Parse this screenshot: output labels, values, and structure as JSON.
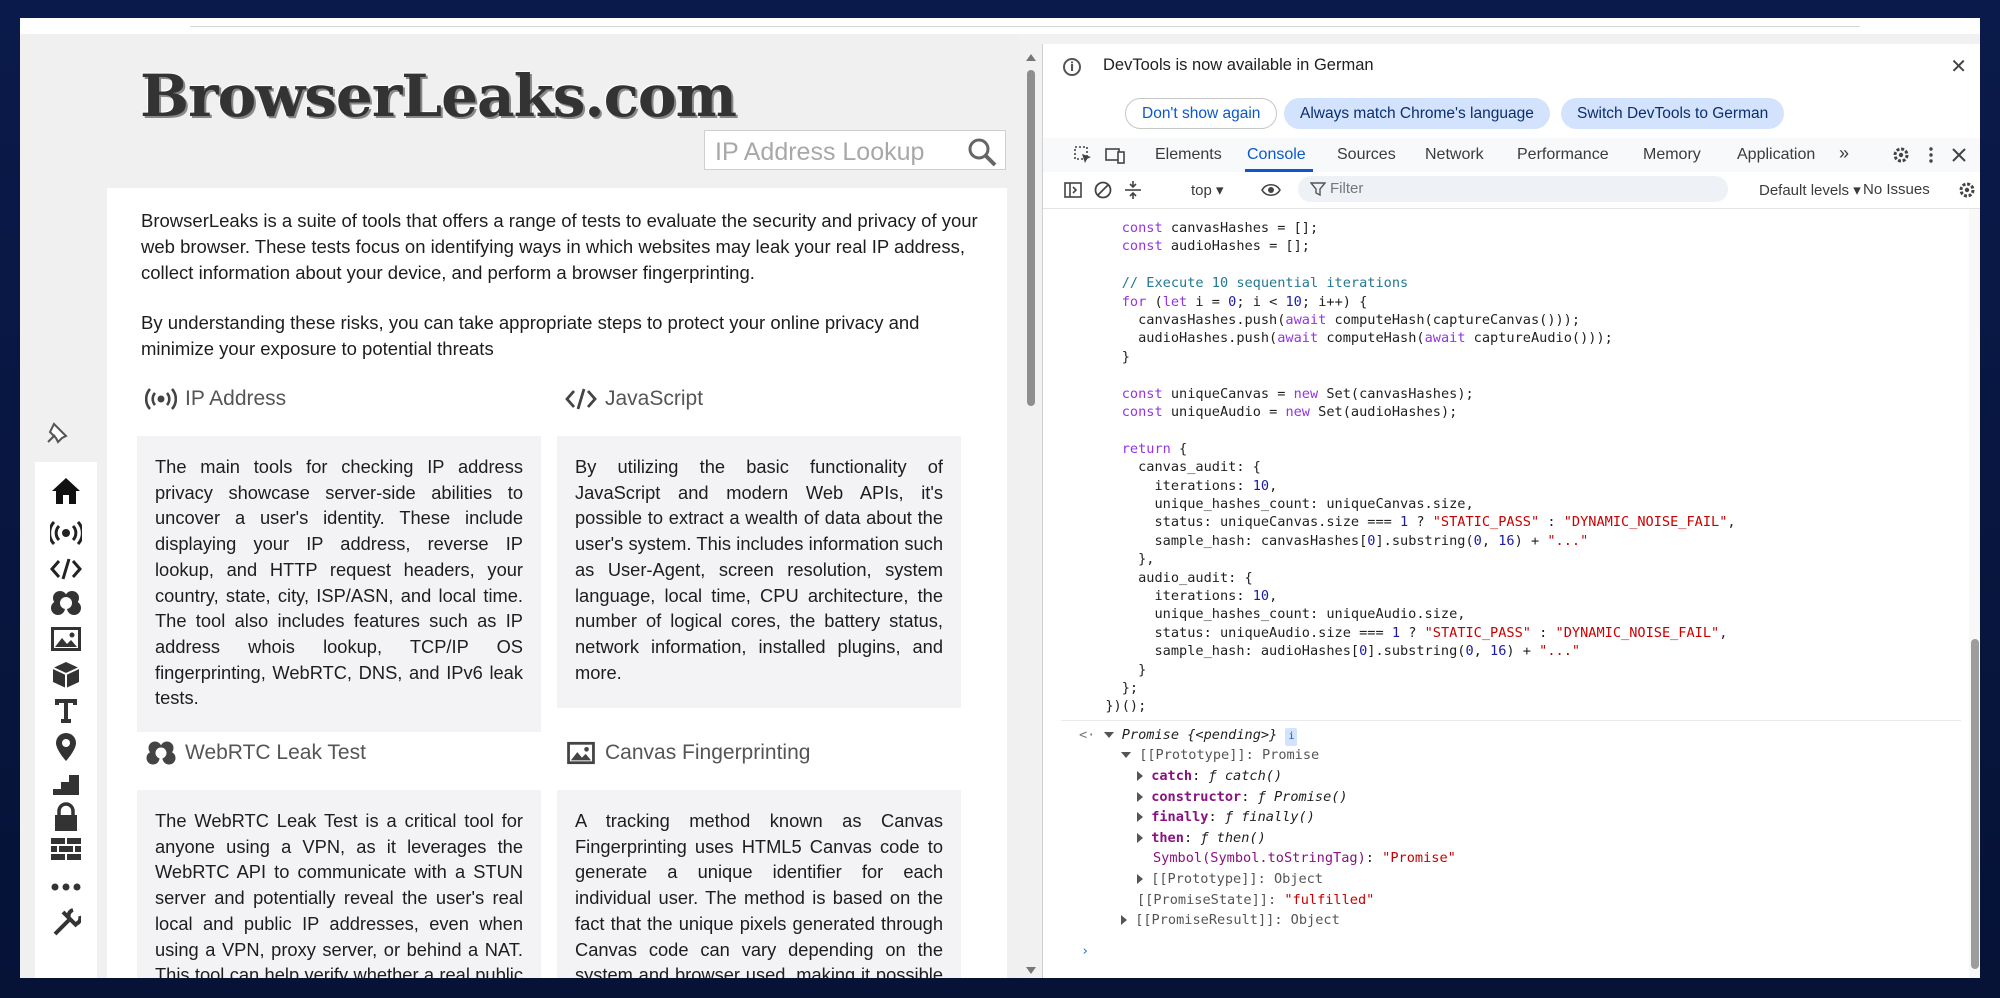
{
  "website": {
    "logo_text": "BrowserLeaks.com",
    "search_placeholder": "IP Address Lookup",
    "intro_p1": "BrowserLeaks is a suite of tools that offers a range of tests to evaluate the security and privacy of your web browser. These tests focus on identifying ways in which websites may leak your real IP address, collect information about your device, and perform a browser fingerprinting.",
    "intro_p2": "By understanding these risks, you can take appropriate steps to protect your online privacy and minimize your exposure to potential threats",
    "cards": [
      {
        "title": "IP Address",
        "icon": "broadcast-icon",
        "text": "The main tools for checking IP address privacy showcase server-side abilities to uncover a user's identity. These include displaying your IP address, reverse IP lookup, and HTTP request headers, your country, state, city, ISP/ASN, and local time. The tool also includes features such as IP address whois lookup, TCP/IP OS fingerprinting, WebRTC, DNS, and IPv6 leak tests."
      },
      {
        "title": "JavaScript",
        "icon": "code-icon",
        "text": "By utilizing the basic functionality of JavaScript and modern Web APIs, it's possible to extract a wealth of data about the user's system. This includes information such as User-Agent, screen resolution, system language, local time, CPU architecture, the number of logical cores, the battery status, network information, installed plugins, and more."
      },
      {
        "title": "WebRTC Leak Test",
        "icon": "webrtc-icon",
        "text": "The WebRTC Leak Test is a critical tool for anyone using a VPN, as it leverages the WebRTC API to communicate with a STUN server and potentially reveal the user's real local and public IP addresses, even when using a VPN, proxy server, or behind a NAT. This tool can help verify whether a real public IP is being leaked."
      },
      {
        "title": "Canvas Fingerprinting",
        "icon": "image-icon",
        "text": "A tracking method known as Canvas Fingerprinting uses HTML5 Canvas code to generate a unique identifier for each individual user. The method is based on the fact that the unique pixels generated through Canvas code can vary depending on the system and browser used, making it possible to identify users."
      }
    ],
    "sidebar_icons": [
      "home-icon",
      "broadcast-icon",
      "code-icon",
      "webrtc-icon",
      "image-icon",
      "cube-icon",
      "text-icon",
      "location-icon",
      "stairs-icon",
      "lock-icon",
      "firewall-icon",
      "more-icon",
      "tools-icon"
    ]
  },
  "devtools": {
    "notice": "DevTools is now available in German",
    "btn_dont_show": "Don't show again",
    "btn_always_match": "Always match Chrome's language",
    "btn_switch": "Switch DevTools to German",
    "tabs": [
      "Elements",
      "Console",
      "Sources",
      "Network",
      "Performance",
      "Memory",
      "Application"
    ],
    "context": "top",
    "filter_placeholder": "Filter",
    "levels": "Default levels",
    "issues": "No Issues"
  },
  "console_lines": [
    "    const canvasHashes = [];",
    "    const audioHashes = [];",
    "",
    "    // Execute 10 sequential iterations",
    "    for (let i = 0; i < 10; i++) {",
    "      canvasHashes.push(await computeHash(captureCanvas()));",
    "      audioHashes.push(await computeHash(await captureAudio()));",
    "    }",
    "",
    "    const uniqueCanvas = new Set(canvasHashes);",
    "    const uniqueAudio = new Set(audioHashes);",
    "",
    "    return {",
    "      canvas_audit: {",
    "        iterations: 10,",
    "        unique_hashes_count: uniqueCanvas.size,",
    "        status: uniqueCanvas.size === 1 ? \"STATIC_PASS\" : \"DYNAMIC_NOISE_FAIL\",",
    "        sample_hash: canvasHashes[0].substring(0, 16) + \"...\"",
    "      },",
    "      audio_audit: {",
    "        iterations: 10,",
    "        unique_hashes_count: uniqueAudio.size,",
    "        status: uniqueAudio.size === 1 ? \"STATIC_PASS\" : \"DYNAMIC_NOISE_FAIL\",",
    "        sample_hash: audioHashes[0].substring(0, 16) + \"...\"",
    "      }",
    "    };",
    "  })();"
  ],
  "result": {
    "promise": "Promise",
    "pending": "{<pending>}",
    "prototype_label": "[[Prototype]]: Promise",
    "members": [
      {
        "name": "catch",
        "value": "ƒ catch()"
      },
      {
        "name": "constructor",
        "value": "ƒ Promise()"
      },
      {
        "name": "finally",
        "value": "ƒ finally()"
      },
      {
        "name": "then",
        "value": "ƒ then()"
      }
    ],
    "symbol_line": "Symbol(Symbol.toStringTag): \"Promise\"",
    "inner_prototype": "[[Prototype]]: Object",
    "state_key": "[[PromiseState]]:",
    "state_val": "\"fulfilled\"",
    "result_line": "[[PromiseResult]]: Object"
  }
}
